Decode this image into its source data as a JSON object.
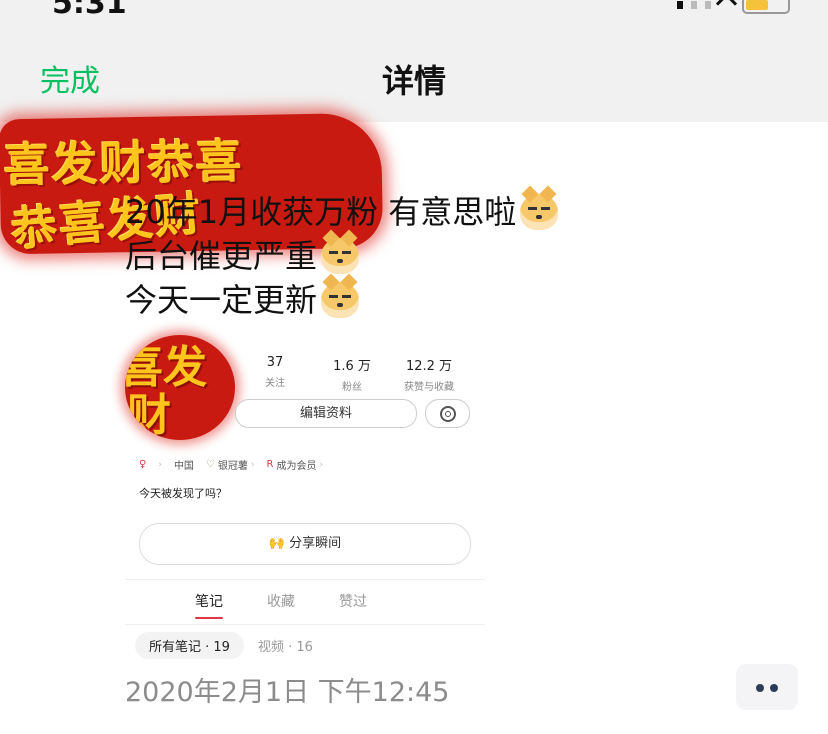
{
  "status_bar": {
    "time": "5:31"
  },
  "nav": {
    "done_label": "完成",
    "title": "详情"
  },
  "banner": {
    "line1": "喜发财恭喜",
    "line2": "恭喜发财"
  },
  "caption": {
    "lines": [
      "20年1月收获万粉 有意思啦",
      "后台催更严重",
      "今天一定更新"
    ]
  },
  "profile": {
    "avatar_line1": "喜发",
    "avatar_line2": "财",
    "stats": [
      {
        "value": "37",
        "label": "关注"
      },
      {
        "value": "1.6 万",
        "label": "粉丝"
      },
      {
        "value": "12.2 万",
        "label": "获赞与收藏"
      }
    ],
    "edit_label": "编辑资料",
    "tags": [
      {
        "icon": "♀",
        "text": "中国"
      },
      {
        "icon": "♡",
        "text": "银冠薯"
      },
      {
        "icon": "R",
        "text": "成为会员"
      }
    ],
    "bio": "今天被发现了吗？",
    "share_label": "分享瞬间",
    "tabs": [
      "笔记",
      "收藏",
      "赞过"
    ],
    "subtabs": [
      "所有笔记 · 19",
      "视频 · 16"
    ]
  },
  "timestamp": "2020年2月1日 下午12:45",
  "colors": {
    "accent_green": "#07c160",
    "festive_red": "#c91a12",
    "festive_gold": "#ffc51d",
    "tab_underline": "#e1374a"
  },
  "icons": [
    "wifi-icon",
    "battery-icon",
    "doge-emoji-icon",
    "gear-icon",
    "pray-hands-icon",
    "more-dots-icon"
  ]
}
